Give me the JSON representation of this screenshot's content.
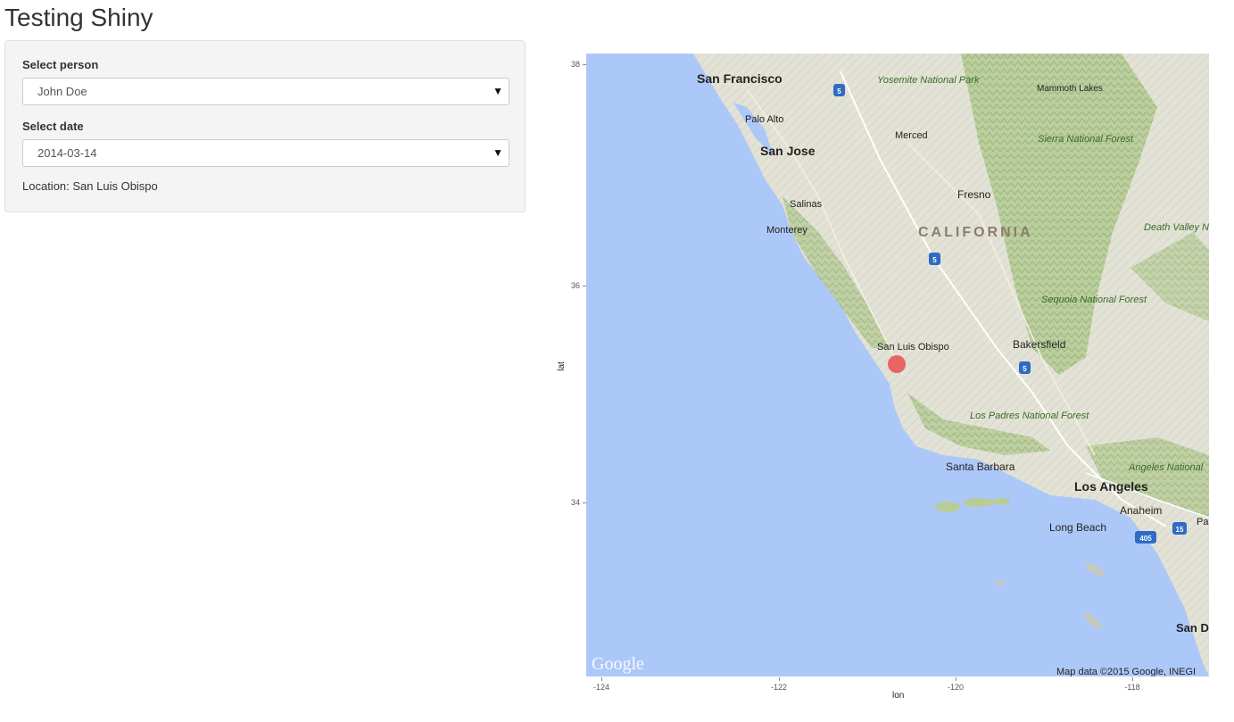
{
  "app": {
    "title": "Testing Shiny"
  },
  "sidebar": {
    "person_label": "Select person",
    "person_value": "John Doe",
    "date_label": "Select date",
    "date_value": "2014-03-14",
    "location_text": "Location: San Luis Obispo"
  },
  "map": {
    "xlabel": "lon",
    "ylabel": "lat",
    "x_ticks": [
      "-124",
      "-122",
      "-120",
      "-118"
    ],
    "y_ticks": [
      "38",
      "36",
      "34"
    ],
    "attribution": "Map data ©2015 Google, INEGI",
    "provider": "Google",
    "marker": {
      "lat": 35.28,
      "lon": -120.66,
      "color": "#e8454a"
    },
    "places": {
      "san_francisco": "San Francisco",
      "palo_alto": "Palo Alto",
      "san_jose": "San Jose",
      "merced": "Merced",
      "yosemite": "Yosemite National Park",
      "mammoth": "Mammoth Lakes",
      "sierra": "Sierra National Forest",
      "fresno": "Fresno",
      "salinas": "Salinas",
      "monterey": "Monterey",
      "california": "CALIFORNIA",
      "death_valley": "Death Valley National Park",
      "sequoia": "Sequoia National Forest",
      "slo": "San Luis Obispo",
      "bakersfield": "Bakersfield",
      "los_padres": "Los Padres National Forest",
      "santa_barbara": "Santa Barbara",
      "angeles": "Angeles National",
      "los_angeles": "Los Angeles",
      "anaheim": "Anaheim",
      "long_beach": "Long Beach",
      "palm": "Pal",
      "san_diego": "San D"
    },
    "highways": {
      "i5": "5",
      "i405": "405",
      "i15": "15"
    }
  }
}
